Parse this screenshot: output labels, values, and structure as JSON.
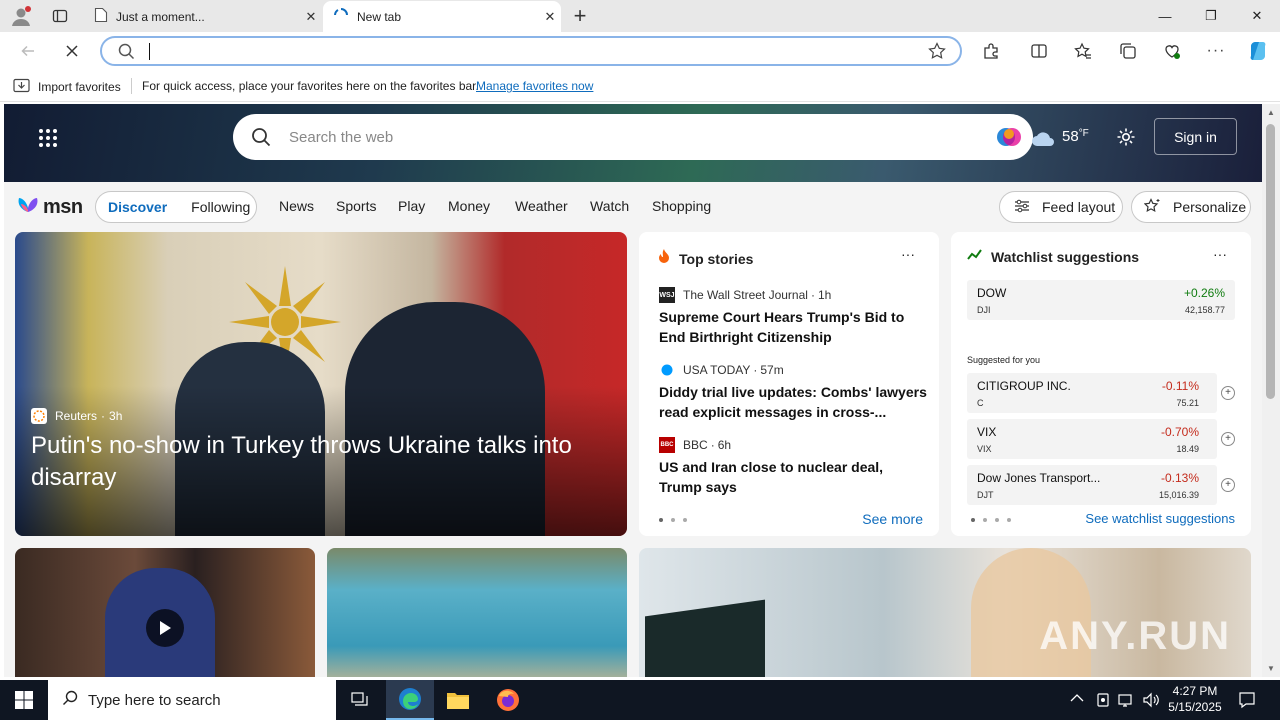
{
  "browser": {
    "tabs": [
      {
        "title": "Just a moment...",
        "active": false
      },
      {
        "title": "New tab",
        "active": true
      }
    ],
    "new_tab_symbol": "+",
    "window_controls": {
      "minimize": "—",
      "restore": "❐",
      "close": "✕"
    },
    "address_value": "",
    "favorites_bar": {
      "import_label": "Import favorites",
      "hint_text": "For quick access, place your favorites here on the favorites bar.",
      "manage_link": "Manage favorites now"
    }
  },
  "msn": {
    "search_placeholder": "Search the web",
    "weather": {
      "temp": "58",
      "unit": "°F"
    },
    "sign_in": "Sign in",
    "logo_text": "msn",
    "feed_tabs": [
      "Discover",
      "Following"
    ],
    "nav_links": [
      "News",
      "Sports",
      "Play",
      "Money",
      "Weather",
      "Watch",
      "Shopping"
    ],
    "feed_layout": "Feed layout",
    "personalize": "Personalize",
    "hero_story": {
      "source": "Reuters",
      "age": "3h",
      "headline": "Putin's no-show in Turkey throws Ukraine talks into disarray"
    },
    "top_stories": {
      "title": "Top stories",
      "more": "···",
      "items": [
        {
          "badge": "WSJ",
          "source": "The Wall Street Journal",
          "age": "1h",
          "headline": "Supreme Court Hears Trump's Bid to End Birthright Citizenship"
        },
        {
          "badge": "",
          "source": "USA TODAY",
          "age": "57m",
          "headline": "Diddy trial live updates: Combs' lawyers read explicit messages in cross-..."
        },
        {
          "badge": "BBC",
          "source": "BBC",
          "age": "6h",
          "headline": "US and Iran close to nuclear deal, Trump says"
        }
      ],
      "see_more": "See more"
    },
    "watchlist": {
      "title": "Watchlist suggestions",
      "more": "···",
      "primary": {
        "name": "DOW",
        "symbol": "DJI",
        "change": "+0.26%",
        "price": "42,158.77"
      },
      "suggested_label": "Suggested for you",
      "suggested": [
        {
          "name": "CITIGROUP INC.",
          "symbol": "C",
          "change": "-0.11%",
          "price": "75.21"
        },
        {
          "name": "VIX",
          "symbol": "VIX",
          "change": "-0.70%",
          "price": "18.49"
        },
        {
          "name": "Dow Jones Transport...",
          "symbol": "DJT",
          "change": "-0.13%",
          "price": "15,016.39"
        }
      ],
      "see_all": "See watchlist suggestions"
    },
    "watermark": "ANY.RUN"
  },
  "taskbar": {
    "search_placeholder": "Type here to search",
    "time": "4:27 PM",
    "date": "5/15/2025"
  },
  "colors": {
    "accent": "#0f6cbd",
    "positive": "#107c10",
    "negative": "#c42b1c"
  }
}
